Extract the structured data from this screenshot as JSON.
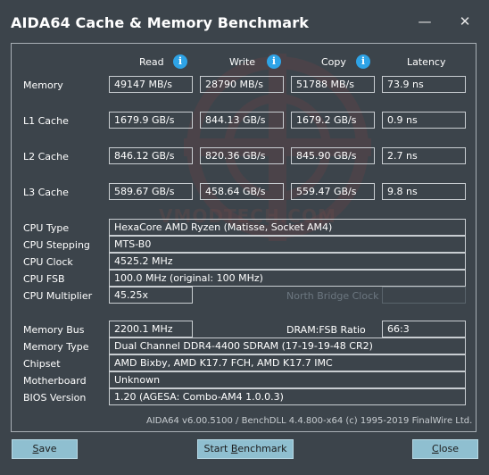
{
  "window": {
    "title": "AIDA64 Cache & Memory Benchmark",
    "minimize_glyph": "—",
    "close_glyph": "✕"
  },
  "columns": {
    "read": "Read",
    "write": "Write",
    "copy": "Copy",
    "latency": "Latency",
    "info_glyph": "i"
  },
  "bench": [
    {
      "label": "Memory",
      "read": "49147 MB/s",
      "write": "28790 MB/s",
      "copy": "51788 MB/s",
      "latency": "73.9 ns"
    },
    {
      "label": "L1 Cache",
      "read": "1679.9 GB/s",
      "write": "844.13 GB/s",
      "copy": "1679.2 GB/s",
      "latency": "0.9 ns"
    },
    {
      "label": "L2 Cache",
      "read": "846.12 GB/s",
      "write": "820.36 GB/s",
      "copy": "845.90 GB/s",
      "latency": "2.7 ns"
    },
    {
      "label": "L3 Cache",
      "read": "589.67 GB/s",
      "write": "458.64 GB/s",
      "copy": "559.47 GB/s",
      "latency": "9.8 ns"
    }
  ],
  "cpu": {
    "type_label": "CPU Type",
    "type": "HexaCore AMD Ryzen  (Matisse, Socket AM4)",
    "stepping_label": "CPU Stepping",
    "stepping": "MTS-B0",
    "clock_label": "CPU Clock",
    "clock": "4525.2 MHz",
    "fsb_label": "CPU FSB",
    "fsb": "100.0 MHz  (original: 100 MHz)",
    "multiplier_label": "CPU Multiplier",
    "multiplier": "45.25x",
    "nb_clock_label": "North Bridge Clock"
  },
  "memory": {
    "bus_label": "Memory Bus",
    "bus": "2200.1 MHz",
    "ratio_label": "DRAM:FSB Ratio",
    "ratio": "66:3",
    "type_label": "Memory Type",
    "type": "Dual Channel DDR4-4400 SDRAM  (17-19-19-48 CR2)",
    "chipset_label": "Chipset",
    "chipset": "AMD Bixby, AMD K17.7 FCH, AMD K17.7 IMC",
    "motherboard_label": "Motherboard",
    "motherboard": "Unknown",
    "bios_label": "BIOS Version",
    "bios": "1.20  (AGESA: Combo-AM4 1.0.0.3)"
  },
  "footer": "AIDA64 v6.00.5100 / BenchDLL 4.4.800-x64  (c) 1995-2019 FinalWire Ltd.",
  "watermark_text": "VMODTECH.COM",
  "buttons": {
    "save_first": "S",
    "save_rest": "ave",
    "bench_pre": "Start ",
    "bench_u": "B",
    "bench_rest": "enchmark",
    "close_first": "C",
    "close_rest": "lose"
  }
}
